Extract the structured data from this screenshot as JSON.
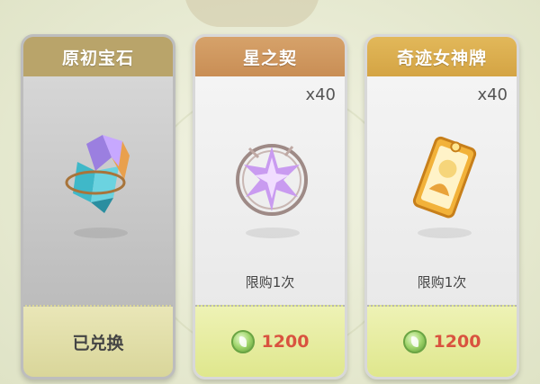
{
  "cards": [
    {
      "title": "原初宝石",
      "status": "已兑换",
      "icon": "primordial-gem-icon"
    },
    {
      "title": "星之契",
      "quantity": "x40",
      "limit": "限购1次",
      "price": "1200",
      "icon": "star-contract-icon",
      "currency_icon": "green-leaf-coin-icon"
    },
    {
      "title": "奇迹女神牌",
      "quantity": "x40",
      "limit": "限购1次",
      "price": "1200",
      "icon": "miracle-goddess-card-icon",
      "currency_icon": "green-leaf-coin-icon"
    }
  ],
  "colors": {
    "price_red": "#d9533f",
    "header_1": "#b9a46a",
    "header_2": "#c98e55",
    "header_3": "#d4a444"
  }
}
